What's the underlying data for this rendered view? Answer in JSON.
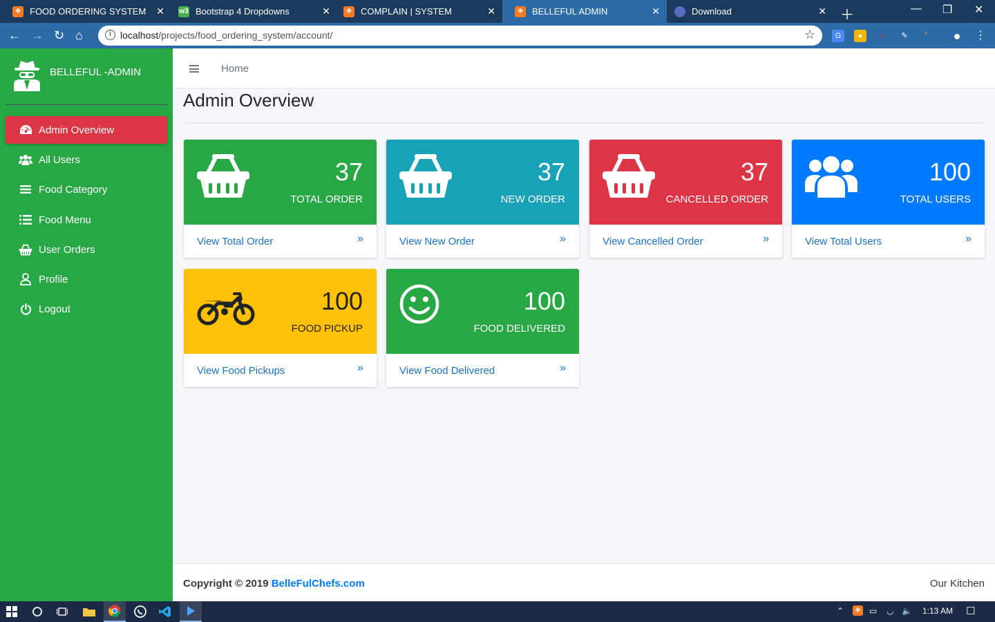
{
  "browser": {
    "tabs": [
      {
        "title": "FOOD ORDERING SYSTEM",
        "icon": "xampp-icon"
      },
      {
        "title": "Bootstrap 4 Dropdowns",
        "icon": "w3schools-icon"
      },
      {
        "title": "COMPLAIN | SYSTEM",
        "icon": "xampp-icon"
      },
      {
        "title": "BELLEFUL ADMIN",
        "icon": "xampp-icon"
      },
      {
        "title": "Download",
        "icon": "globe-icon"
      }
    ],
    "url_host": "localhost",
    "url_path": "/projects/food_ordering_system/account/"
  },
  "sidebar": {
    "brand": "BELLEFUL -ADMIN",
    "items": [
      {
        "label": "Admin Overview",
        "icon": "dashboard-icon",
        "active": true
      },
      {
        "label": "All Users",
        "icon": "users-icon"
      },
      {
        "label": "Food Category",
        "icon": "list-icon"
      },
      {
        "label": "Food Menu",
        "icon": "list-ul-icon"
      },
      {
        "label": "User Orders",
        "icon": "basket-icon"
      },
      {
        "label": "Profile",
        "icon": "user-icon"
      },
      {
        "label": "Logout",
        "icon": "power-icon"
      }
    ]
  },
  "topnav": {
    "home": "Home"
  },
  "page": {
    "title": "Admin Overview"
  },
  "cards": [
    {
      "value": "37",
      "label": "TOTAL ORDER",
      "link": "View Total Order",
      "color": "#28a745",
      "icon": "basket-icon"
    },
    {
      "value": "37",
      "label": "NEW ORDER",
      "link": "View New Order",
      "color": "#17a2b8",
      "icon": "basket-icon"
    },
    {
      "value": "37",
      "label": "CANCELLED ORDER",
      "link": "View Cancelled Order",
      "color": "#dc3545",
      "icon": "basket-icon"
    },
    {
      "value": "100",
      "label": "TOTAL USERS",
      "link": "View Total Users",
      "color": "#007bff",
      "icon": "users-icon"
    },
    {
      "value": "100",
      "label": "FOOD PICKUP",
      "link": "View Food Pickups",
      "color": "#ffc107",
      "icon": "motorcycle-icon"
    },
    {
      "value": "100",
      "label": "FOOD DELIVERED",
      "link": "View Food Delivered",
      "color": "#28a745",
      "icon": "smile-icon"
    }
  ],
  "footer": {
    "copyright": "Copyright © 2019 ",
    "link": "BelleFulChefs.com",
    "right": "Our Kitchen"
  },
  "taskbar": {
    "time": "1:13 AM"
  }
}
